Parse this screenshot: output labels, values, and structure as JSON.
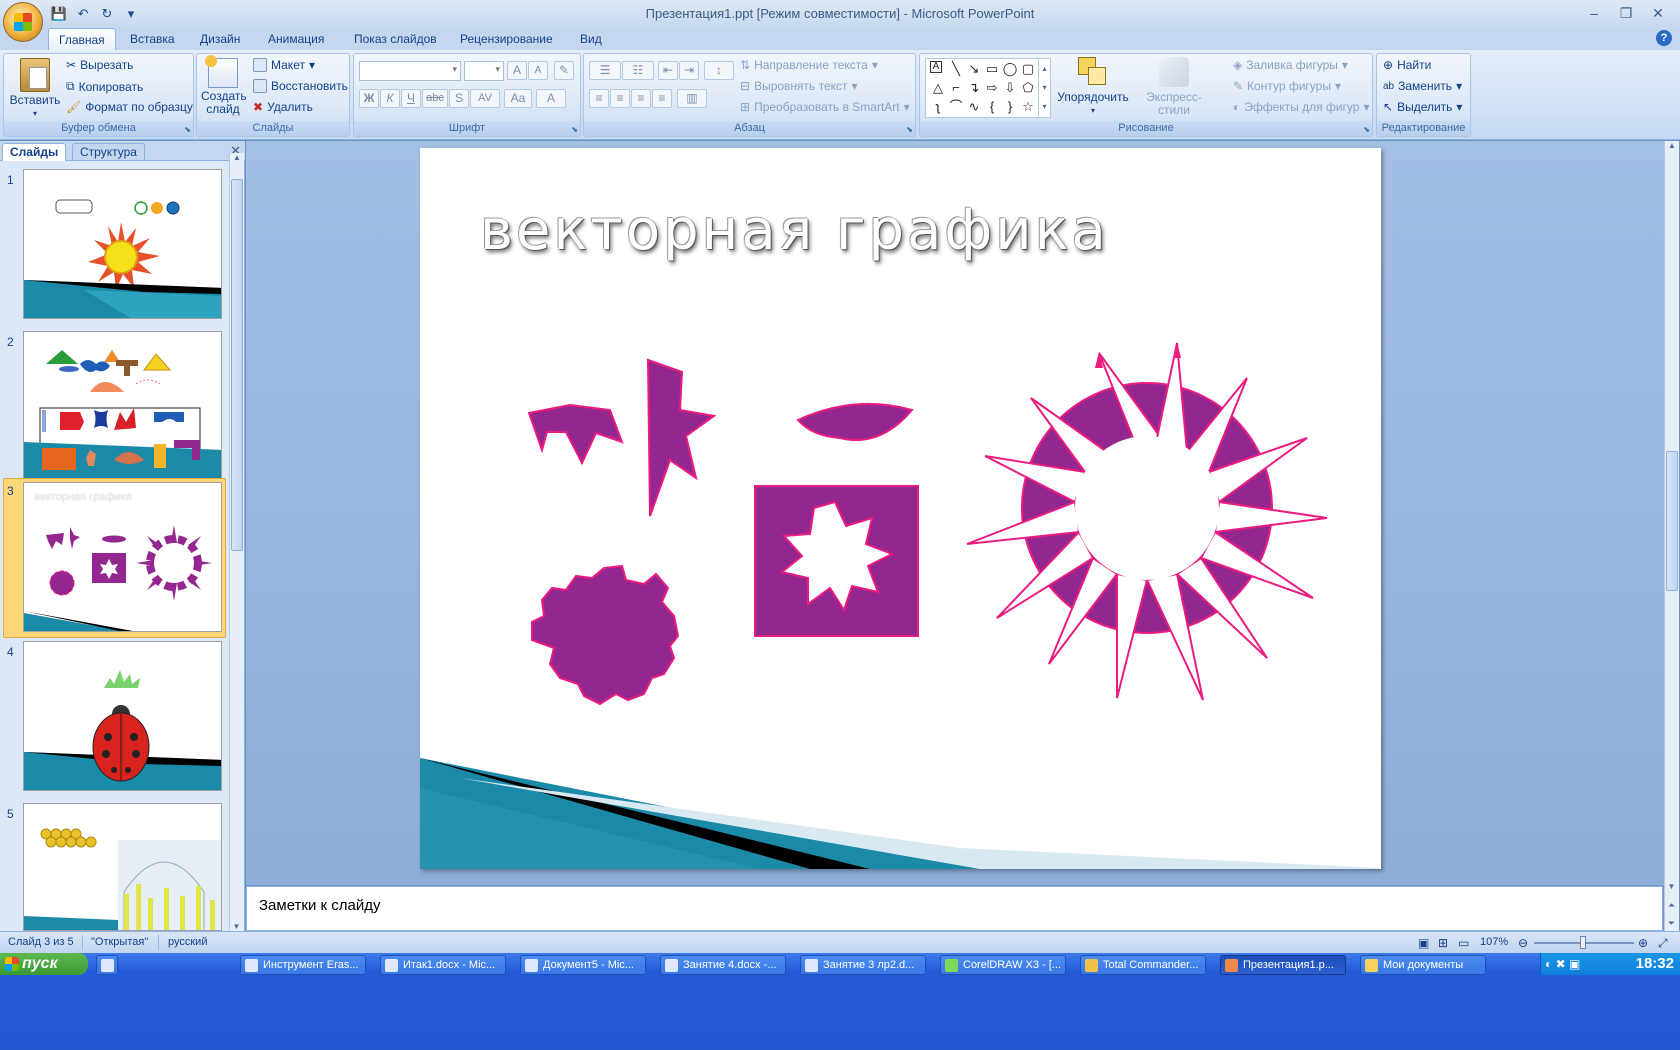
{
  "window": {
    "title": "Презентация1.ppt [Режим совместимости] - Microsoft PowerPoint",
    "controls": [
      "–",
      "❐",
      "✕"
    ]
  },
  "qat": {
    "items": [
      "save-icon",
      "undo-icon",
      "redo-icon",
      "customize-icon"
    ]
  },
  "tabs": [
    {
      "label": "Главная",
      "active": true
    },
    {
      "label": "Вставка"
    },
    {
      "label": "Дизайн"
    },
    {
      "label": "Анимация"
    },
    {
      "label": "Показ слайдов"
    },
    {
      "label": "Рецензирование"
    },
    {
      "label": "Вид"
    }
  ],
  "ribbon": {
    "clipboard": {
      "label": "Буфер обмена",
      "paste": "Вставить",
      "cut": "Вырезать",
      "copy": "Копировать",
      "format_painter": "Формат по образцу"
    },
    "slides": {
      "label": "Слайды",
      "new_slide": "Создать слайд",
      "layout": "Макет",
      "reset": "Восстановить",
      "delete": "Удалить"
    },
    "font": {
      "label": "Шрифт",
      "bold": "Ж",
      "italic": "К",
      "underline": "Ч",
      "strike": "abc",
      "shadow": "S",
      "spacing": "AV",
      "case": "Aa",
      "color": "A",
      "grow": "A",
      "shrink": "A"
    },
    "paragraph": {
      "label": "Абзац",
      "text_direction": "Направление текста",
      "align_text": "Выровнять текст",
      "smartart": "Преобразовать в SmartArt"
    },
    "drawing": {
      "label": "Рисование",
      "arrange": "Упорядочить",
      "quick_styles": "Экспресс-стили",
      "fill": "Заливка фигуры",
      "outline": "Контур фигуры",
      "effects": "Эффекты для фигур"
    },
    "editing": {
      "label": "Редактирование",
      "find": "Найти",
      "replace": "Заменить",
      "select": "Выделить"
    }
  },
  "left_pane": {
    "tabs": [
      "Слайды",
      "Структура"
    ],
    "slides": [
      {
        "number": "1"
      },
      {
        "number": "2"
      },
      {
        "number": "3",
        "title": "векторная графика",
        "selected": true
      },
      {
        "number": "4"
      },
      {
        "number": "5"
      }
    ]
  },
  "slide": {
    "title": "векторная графика"
  },
  "notes": {
    "placeholder": "Заметки к слайду"
  },
  "status": {
    "slide_info": "Слайд 3 из 5",
    "theme": "\"Открытая\"",
    "language": "русский",
    "zoom": "107%"
  },
  "taskbar": {
    "start": "пуск",
    "items": [
      {
        "label": "Инструмент Eras..."
      },
      {
        "label": "Итак1.docx - Mic..."
      },
      {
        "label": "Документ5 - Mic..."
      },
      {
        "label": "Занятие 4.docx -..."
      },
      {
        "label": "Занятие 3 лр2.d..."
      },
      {
        "label": "CorelDRAW X3 - [..."
      },
      {
        "label": "Total Commander..."
      },
      {
        "label": "Презентация1.p...",
        "active": true
      },
      {
        "label": "Мои документы"
      }
    ],
    "clock": "18:32"
  },
  "colors": {
    "shape_fill": "#93278f",
    "shape_stroke": "#ec1b7f",
    "ribbon_text": "#15428b"
  }
}
